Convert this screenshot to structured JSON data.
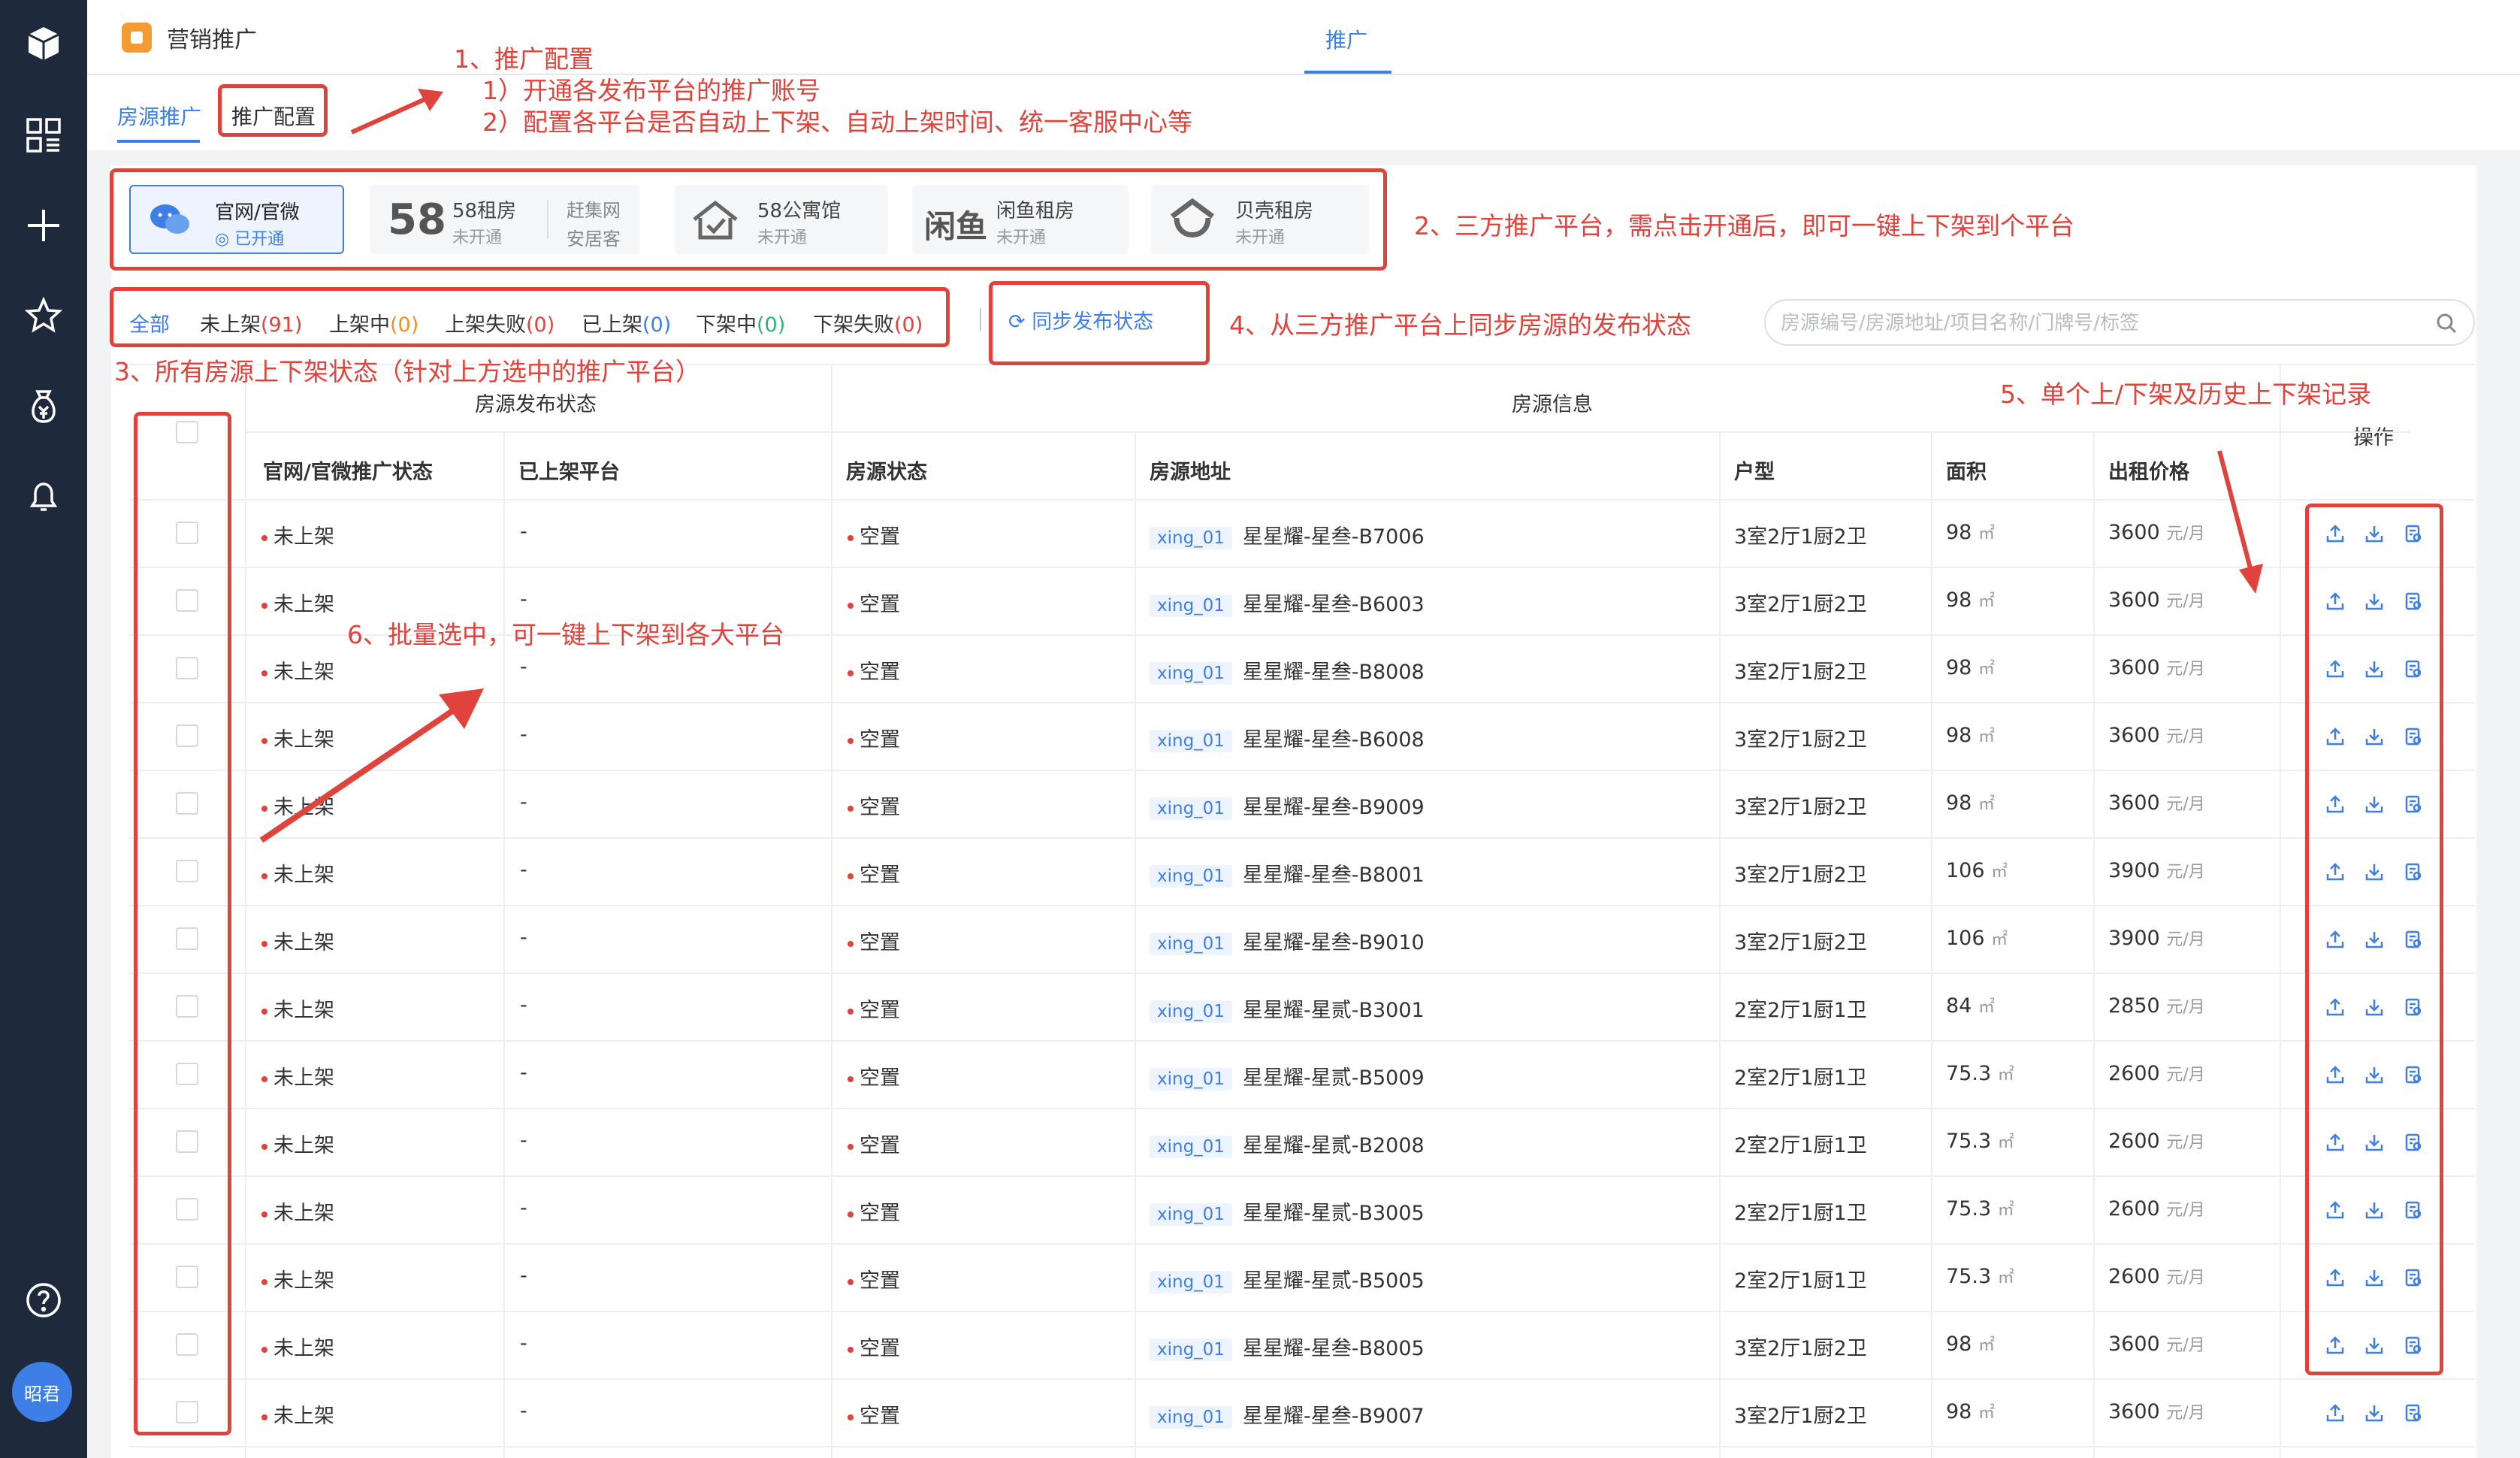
{
  "app": {
    "title": "营销推广",
    "top_tab": "推广"
  },
  "sidebar": {
    "avatar": "昭君"
  },
  "subtabs": {
    "house_promo": "房源推广",
    "promo_config": "推广配置"
  },
  "platforms": [
    {
      "name": "官网/官微",
      "status": "已开通"
    },
    {
      "name": "58租房",
      "name2": "赶集网",
      "status": "未开通",
      "status2": "安居客",
      "logo": "58"
    },
    {
      "name": "58公寓馆",
      "status": "未开通"
    },
    {
      "name": "闲鱼租房",
      "status": "未开通",
      "logo": "闲鱼"
    },
    {
      "name": "贝壳租房",
      "status": "未开通"
    }
  ],
  "filters": {
    "all": "全部",
    "not_listed": "未上架",
    "not_listed_count": "(91)",
    "listing": "上架中",
    "listing_count": "(0)",
    "list_failed": "上架失败",
    "list_failed_count": "(0)",
    "listed": "已上架",
    "listed_count": "(0)",
    "delisting": "下架中",
    "delisting_count": "(0)",
    "delist_failed": "下架失败",
    "delist_failed_count": "(0)"
  },
  "sync_button": "同步发布状态",
  "search": {
    "placeholder": "房源编号/房源地址/项目名称/门牌号/标签"
  },
  "table": {
    "group_publish": "房源发布状态",
    "group_info": "房源信息",
    "col_promo_status": "官网/官微推广状态",
    "col_platforms": "已上架平台",
    "col_house_status": "房源状态",
    "col_address": "房源地址",
    "col_layout": "户型",
    "col_area": "面积",
    "col_price": "出租价格",
    "col_ops": "操作",
    "unit_area": "㎡",
    "unit_price": "元/月",
    "rows": [
      {
        "promo": "未上架",
        "platforms": "-",
        "status": "空置",
        "tag": "xing_01",
        "address": "星星耀-星叁-B7006",
        "layout": "3室2厅1厨2卫",
        "area": "98",
        "price": "3600"
      },
      {
        "promo": "未上架",
        "platforms": "-",
        "status": "空置",
        "tag": "xing_01",
        "address": "星星耀-星叁-B6003",
        "layout": "3室2厅1厨2卫",
        "area": "98",
        "price": "3600"
      },
      {
        "promo": "未上架",
        "platforms": "-",
        "status": "空置",
        "tag": "xing_01",
        "address": "星星耀-星叁-B8008",
        "layout": "3室2厅1厨2卫",
        "area": "98",
        "price": "3600"
      },
      {
        "promo": "未上架",
        "platforms": "-",
        "status": "空置",
        "tag": "xing_01",
        "address": "星星耀-星叁-B6008",
        "layout": "3室2厅1厨2卫",
        "area": "98",
        "price": "3600"
      },
      {
        "promo": "未上架",
        "platforms": "-",
        "status": "空置",
        "tag": "xing_01",
        "address": "星星耀-星叁-B9009",
        "layout": "3室2厅1厨2卫",
        "area": "98",
        "price": "3600"
      },
      {
        "promo": "未上架",
        "platforms": "-",
        "status": "空置",
        "tag": "xing_01",
        "address": "星星耀-星叁-B8001",
        "layout": "3室2厅1厨2卫",
        "area": "106",
        "price": "3900"
      },
      {
        "promo": "未上架",
        "platforms": "-",
        "status": "空置",
        "tag": "xing_01",
        "address": "星星耀-星叁-B9010",
        "layout": "3室2厅1厨2卫",
        "area": "106",
        "price": "3900"
      },
      {
        "promo": "未上架",
        "platforms": "-",
        "status": "空置",
        "tag": "xing_01",
        "address": "星星耀-星贰-B3001",
        "layout": "2室2厅1厨1卫",
        "area": "84",
        "price": "2850"
      },
      {
        "promo": "未上架",
        "platforms": "-",
        "status": "空置",
        "tag": "xing_01",
        "address": "星星耀-星贰-B5009",
        "layout": "2室2厅1厨1卫",
        "area": "75.3",
        "price": "2600"
      },
      {
        "promo": "未上架",
        "platforms": "-",
        "status": "空置",
        "tag": "xing_01",
        "address": "星星耀-星贰-B2008",
        "layout": "2室2厅1厨1卫",
        "area": "75.3",
        "price": "2600"
      },
      {
        "promo": "未上架",
        "platforms": "-",
        "status": "空置",
        "tag": "xing_01",
        "address": "星星耀-星贰-B3005",
        "layout": "2室2厅1厨1卫",
        "area": "75.3",
        "price": "2600"
      },
      {
        "promo": "未上架",
        "platforms": "-",
        "status": "空置",
        "tag": "xing_01",
        "address": "星星耀-星贰-B5005",
        "layout": "2室2厅1厨1卫",
        "area": "75.3",
        "price": "2600"
      },
      {
        "promo": "未上架",
        "platforms": "-",
        "status": "空置",
        "tag": "xing_01",
        "address": "星星耀-星叁-B8005",
        "layout": "3室2厅1厨2卫",
        "area": "98",
        "price": "3600"
      },
      {
        "promo": "未上架",
        "platforms": "-",
        "status": "空置",
        "tag": "xing_01",
        "address": "星星耀-星叁-B9007",
        "layout": "3室2厅1厨2卫",
        "area": "98",
        "price": "3600"
      }
    ]
  },
  "annotations": {
    "a1_title": "1、推广配置",
    "a1_line1": "1）开通各发布平台的推广账号",
    "a1_line2": "2）配置各平台是否自动上下架、自动上架时间、统一客服中心等",
    "a2": "2、三方推广平台，需点击开通后，即可一键上下架到个平台",
    "a3": "3、所有房源上下架状态（针对上方选中的推广平台）",
    "a4": "4、从三方推广平台上同步房源的发布状态",
    "a5": "5、单个上/下架及历史上下架记录",
    "a6": "6、批量选中，可一键上下架到各大平台"
  },
  "colors": {
    "accent": "#3d7fe6",
    "annotation": "#e0433b",
    "sidebar": "#1e2a3b"
  }
}
